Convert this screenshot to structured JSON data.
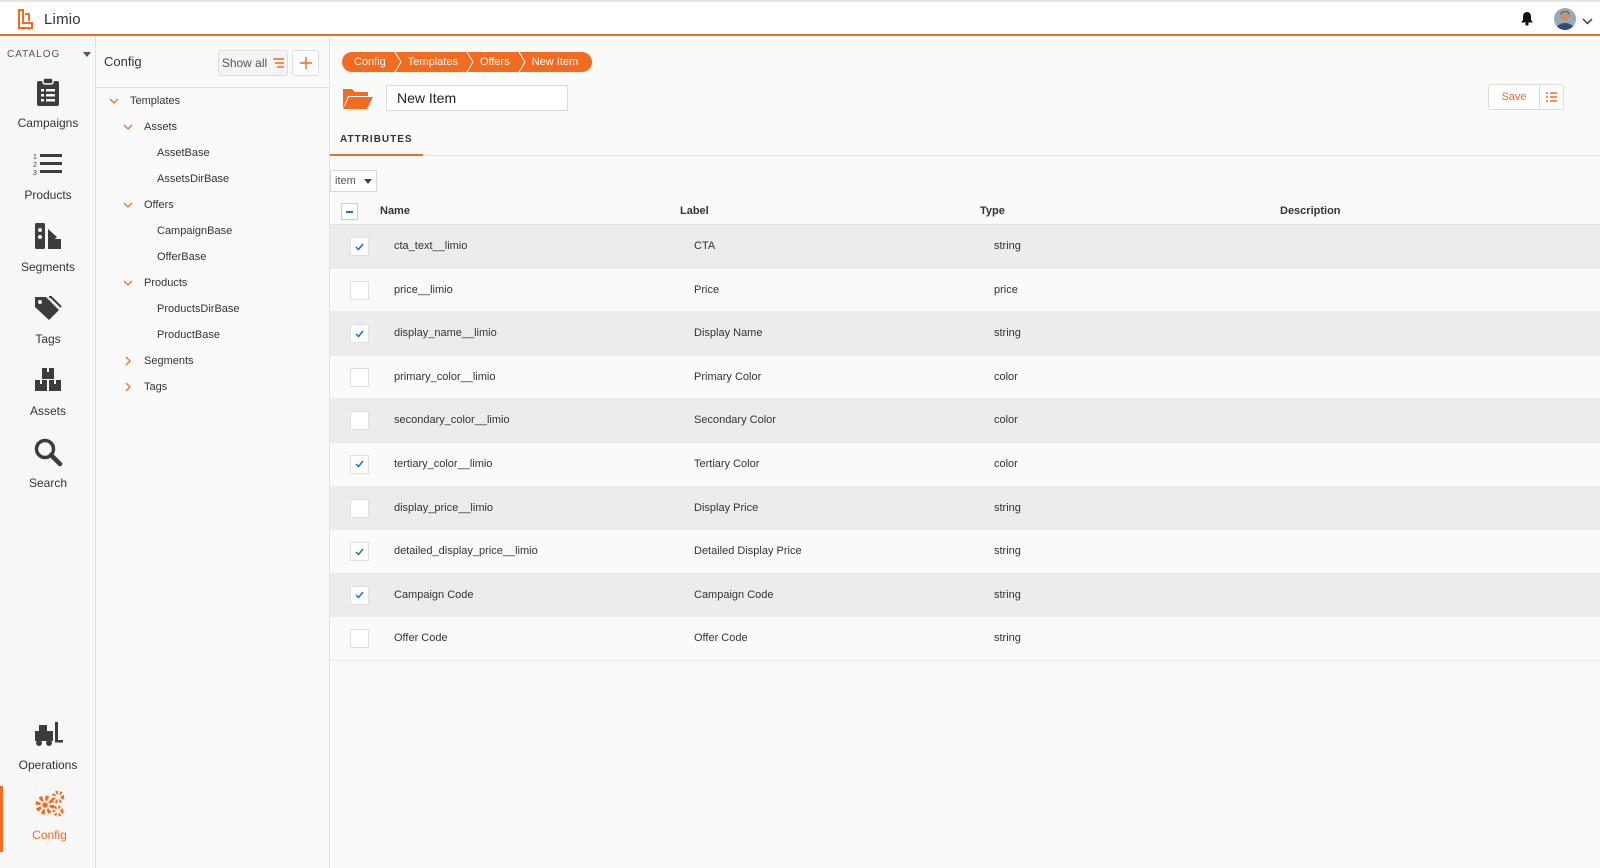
{
  "app": {
    "name": "Limio"
  },
  "colors": {
    "accent": "#f26b21",
    "check": "#1a73c9"
  },
  "icons": {
    "notifications": "bell-icon",
    "user": "avatar",
    "menu": "chevron-down-icon"
  },
  "nav": {
    "section_label": "CATALOG",
    "items": [
      {
        "label": "Campaigns",
        "icon": "clipboard-icon"
      },
      {
        "label": "Products",
        "icon": "list-icon"
      },
      {
        "label": "Segments",
        "icon": "segments-icon"
      },
      {
        "label": "Tags",
        "icon": "tag-icon"
      },
      {
        "label": "Assets",
        "icon": "boxes-icon"
      },
      {
        "label": "Search",
        "icon": "search-icon"
      }
    ],
    "bottom_items": [
      {
        "label": "Operations",
        "icon": "forklift-icon"
      },
      {
        "label": "Config",
        "icon": "gears-icon",
        "active": true
      }
    ]
  },
  "tree": {
    "title": "Config",
    "show_all_label": "Show all",
    "nodes": [
      {
        "label": "Templates",
        "expanded": true
      },
      {
        "label": "Assets",
        "expanded": true
      },
      {
        "label": "AssetBase"
      },
      {
        "label": "AssetsDirBase"
      },
      {
        "label": "Offers",
        "expanded": true
      },
      {
        "label": "CampaignBase"
      },
      {
        "label": "OfferBase"
      },
      {
        "label": "Products",
        "expanded": true
      },
      {
        "label": "ProductsDirBase"
      },
      {
        "label": "ProductBase"
      },
      {
        "label": "Segments",
        "expanded": false
      },
      {
        "label": "Tags",
        "expanded": false
      }
    ]
  },
  "breadcrumb": [
    "Config",
    "Templates",
    "Offers",
    "New Item"
  ],
  "item": {
    "name": "New Item"
  },
  "toolbar": {
    "save_label": "Save"
  },
  "tabs": [
    {
      "label": "ATTRIBUTES",
      "active": true
    }
  ],
  "filter": {
    "selected": "item"
  },
  "table": {
    "columns": [
      "Name",
      "Label",
      "Type",
      "Description"
    ],
    "rows": [
      {
        "name": "cta_text__limio",
        "label": "CTA",
        "type": "string",
        "description": "",
        "checked": true
      },
      {
        "name": "price__limio",
        "label": "Price",
        "type": "price",
        "description": "",
        "checked": false
      },
      {
        "name": "display_name__limio",
        "label": "Display Name",
        "type": "string",
        "description": "",
        "checked": true
      },
      {
        "name": "primary_color__limio",
        "label": "Primary Color",
        "type": "color",
        "description": "",
        "checked": false
      },
      {
        "name": "secondary_color__limio",
        "label": "Secondary Color",
        "type": "color",
        "description": "",
        "checked": false
      },
      {
        "name": "tertiary_color__limio",
        "label": "Tertiary Color",
        "type": "color",
        "description": "",
        "checked": true
      },
      {
        "name": "display_price__limio",
        "label": "Display Price",
        "type": "string",
        "description": "",
        "checked": false
      },
      {
        "name": "detailed_display_price__limio",
        "label": "Detailed Display Price",
        "type": "string",
        "description": "",
        "checked": true
      },
      {
        "name": "Campaign Code",
        "label": "Campaign Code",
        "type": "string",
        "description": "",
        "checked": true
      },
      {
        "name": "Offer Code",
        "label": "Offer Code",
        "type": "string",
        "description": "",
        "checked": false
      }
    ]
  }
}
